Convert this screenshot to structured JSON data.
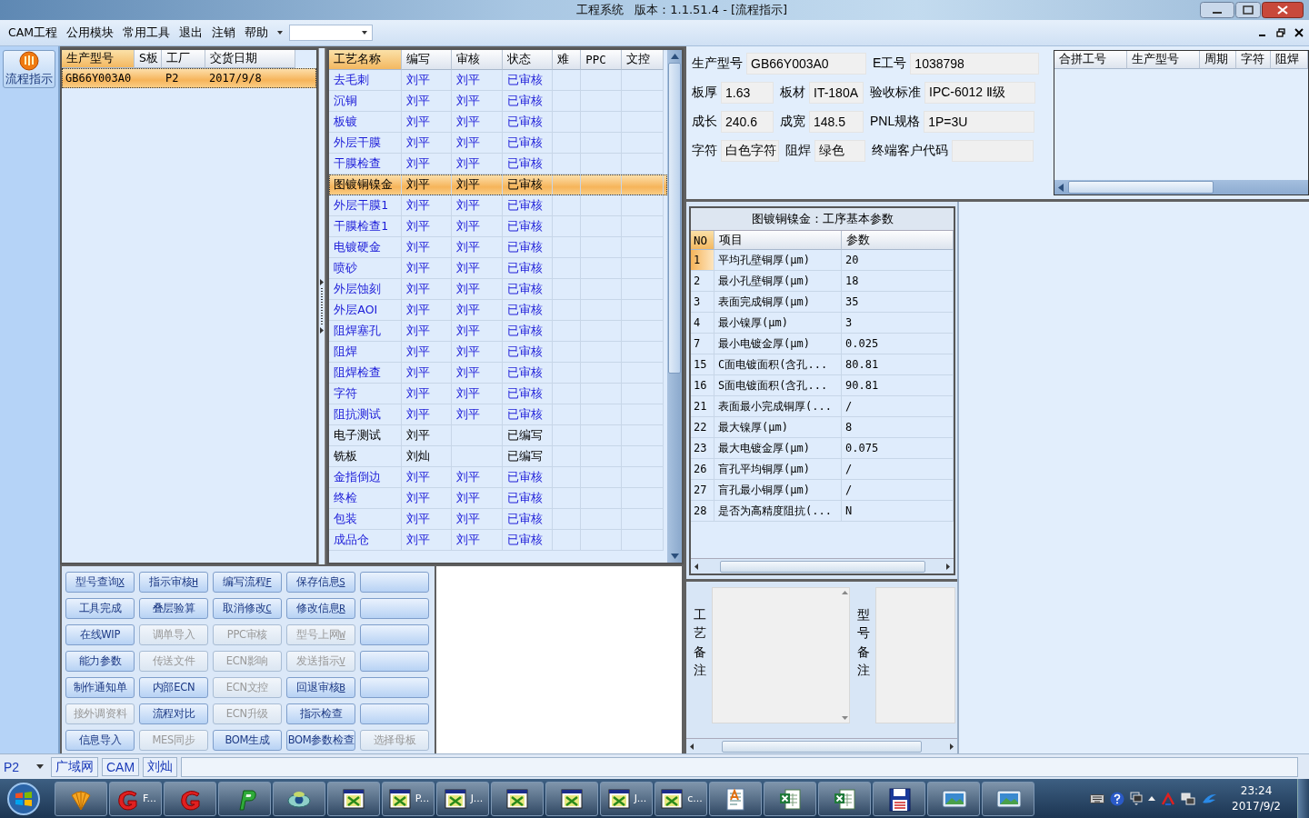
{
  "window": {
    "title": "工程系统   版本：1.1.51.4 - [流程指示]"
  },
  "menu": {
    "items": [
      "CAM工程",
      "公用模块",
      "常用工具",
      "退出",
      "注销",
      "帮助"
    ]
  },
  "side_button": {
    "label": "流程指示"
  },
  "product_table": {
    "columns": [
      "生产型号",
      "S板",
      "工厂",
      "交货日期"
    ],
    "rows": [
      {
        "model": "GB66Y003A0",
        "factory": "P2",
        "delivery": "2017/9/8",
        "selected": true
      }
    ]
  },
  "process_table": {
    "columns": [
      "工艺名称",
      "编写",
      "审核",
      "状态",
      "难",
      "PPC",
      "文控"
    ],
    "rows": [
      {
        "name": "去毛刺",
        "writer": "刘平",
        "reviewer": "刘平",
        "status": "已审核",
        "approved": true,
        "selected": false
      },
      {
        "name": "沉铜",
        "writer": "刘平",
        "reviewer": "刘平",
        "status": "已审核",
        "approved": true,
        "selected": false
      },
      {
        "name": "板镀",
        "writer": "刘平",
        "reviewer": "刘平",
        "status": "已审核",
        "approved": true,
        "selected": false
      },
      {
        "name": "外层干膜",
        "writer": "刘平",
        "reviewer": "刘平",
        "status": "已审核",
        "approved": true,
        "selected": false
      },
      {
        "name": "干膜检查",
        "writer": "刘平",
        "reviewer": "刘平",
        "status": "已审核",
        "approved": true,
        "selected": false
      },
      {
        "name": "图镀铜镍金",
        "writer": "刘平",
        "reviewer": "刘平",
        "status": "已审核",
        "approved": true,
        "selected": true
      },
      {
        "name": "外层干膜1",
        "writer": "刘平",
        "reviewer": "刘平",
        "status": "已审核",
        "approved": true,
        "selected": false
      },
      {
        "name": "干膜检查1",
        "writer": "刘平",
        "reviewer": "刘平",
        "status": "已审核",
        "approved": true,
        "selected": false
      },
      {
        "name": "电镀硬金",
        "writer": "刘平",
        "reviewer": "刘平",
        "status": "已审核",
        "approved": true,
        "selected": false
      },
      {
        "name": "喷砂",
        "writer": "刘平",
        "reviewer": "刘平",
        "status": "已审核",
        "approved": true,
        "selected": false
      },
      {
        "name": "外层蚀刻",
        "writer": "刘平",
        "reviewer": "刘平",
        "status": "已审核",
        "approved": true,
        "selected": false
      },
      {
        "name": "外层AOI",
        "writer": "刘平",
        "reviewer": "刘平",
        "status": "已审核",
        "approved": true,
        "selected": false
      },
      {
        "name": "阻焊塞孔",
        "writer": "刘平",
        "reviewer": "刘平",
        "status": "已审核",
        "approved": true,
        "selected": false
      },
      {
        "name": "阻焊",
        "writer": "刘平",
        "reviewer": "刘平",
        "status": "已审核",
        "approved": true,
        "selected": false
      },
      {
        "name": "阻焊检查",
        "writer": "刘平",
        "reviewer": "刘平",
        "status": "已审核",
        "approved": true,
        "selected": false
      },
      {
        "name": "字符",
        "writer": "刘平",
        "reviewer": "刘平",
        "status": "已审核",
        "approved": true,
        "selected": false
      },
      {
        "name": "阻抗测试",
        "writer": "刘平",
        "reviewer": "刘平",
        "status": "已审核",
        "approved": true,
        "selected": false
      },
      {
        "name": "电子测试",
        "writer": "刘平",
        "status": "已编写",
        "approved": false,
        "selected": false
      },
      {
        "name": "铣板",
        "writer": "刘灿",
        "status": "已编写",
        "approved": false,
        "selected": false
      },
      {
        "name": "金指倒边",
        "writer": "刘平",
        "reviewer": "刘平",
        "status": "已审核",
        "approved": true,
        "selected": false
      },
      {
        "name": "终检",
        "writer": "刘平",
        "reviewer": "刘平",
        "status": "已审核",
        "approved": true,
        "selected": false
      },
      {
        "name": "包装",
        "writer": "刘平",
        "reviewer": "刘平",
        "status": "已审核",
        "approved": true,
        "selected": false
      },
      {
        "name": "成品仓",
        "writer": "刘平",
        "reviewer": "刘平",
        "status": "已审核",
        "approved": true,
        "selected": false
      }
    ]
  },
  "buttons": [
    {
      "label": "型号查询",
      "key": "X",
      "disabled": false
    },
    {
      "label": "指示审核",
      "key": "H",
      "disabled": false
    },
    {
      "label": "编写流程",
      "key": "F",
      "disabled": false
    },
    {
      "label": "保存信息",
      "key": "S",
      "disabled": false
    },
    {
      "disabled": false
    },
    {
      "label": "工具完成",
      "disabled": false
    },
    {
      "label": "叠层验算",
      "disabled": false
    },
    {
      "label": "取消修改",
      "key": "C",
      "disabled": false
    },
    {
      "label": "修改信息",
      "key": "R",
      "disabled": false
    },
    {
      "disabled": false
    },
    {
      "label": "在线WIP",
      "disabled": false
    },
    {
      "label": "调单导入",
      "disabled": true
    },
    {
      "label": "PPC审核",
      "disabled": true
    },
    {
      "label": "型号上网",
      "key": "W",
      "disabled": true
    },
    {
      "disabled": false
    },
    {
      "label": "能力参数",
      "disabled": false
    },
    {
      "label": "传送文件",
      "disabled": true
    },
    {
      "label": "ECN影响",
      "disabled": true
    },
    {
      "label": "发送指示",
      "key": "V",
      "disabled": true
    },
    {
      "disabled": false
    },
    {
      "label": "制作通知单",
      "disabled": false
    },
    {
      "label": "内部ECN",
      "disabled": false
    },
    {
      "label": "ECN文控",
      "disabled": true
    },
    {
      "label": "回退审核",
      "key": "B",
      "disabled": false
    },
    {
      "disabled": false
    },
    {
      "label": "接外调资料",
      "disabled": true
    },
    {
      "label": "流程对比",
      "disabled": false
    },
    {
      "label": "ECN升级",
      "disabled": true
    },
    {
      "label": "指示检查",
      "disabled": false
    },
    {
      "disabled": false
    },
    {
      "label": "信息导入",
      "disabled": false
    },
    {
      "label": "MES同步",
      "disabled": true
    },
    {
      "label": "BOM生成",
      "disabled": false
    },
    {
      "label": "BOM参数检查",
      "disabled": false
    },
    {
      "label": "选择母板",
      "disabled": true
    }
  ],
  "info": {
    "fields": [
      {
        "label": "生产型号",
        "value": "GB66Y003A0"
      },
      {
        "label": "E工号",
        "value": "1038798"
      },
      {
        "label": "板厚",
        "value": "1.63"
      },
      {
        "label": "板材",
        "value": "IT-180A"
      },
      {
        "label": "验收标准",
        "value": "IPC-6012 Ⅱ级"
      },
      {
        "label": "成长",
        "value": "240.6"
      },
      {
        "label": "成宽",
        "value": "148.5"
      },
      {
        "label": "PNL规格",
        "value": "1P=3U"
      },
      {
        "label": "字符",
        "value": "白色字符"
      },
      {
        "label": "阻焊",
        "value": "绿色"
      },
      {
        "label": "终端客户代码"
      }
    ]
  },
  "merge_table": {
    "columns": [
      "合拼工号",
      "生产型号",
      "周期",
      "字符",
      "阻焊"
    ]
  },
  "params": {
    "title": "图镀铜镍金：工序基本参数",
    "columns": [
      "NO",
      "项目",
      "参数"
    ],
    "rows": [
      {
        "no": "1",
        "item": "平均孔壁铜厚(μm)",
        "value": "20",
        "selected": true
      },
      {
        "no": "2",
        "item": "最小孔壁铜厚(μm)",
        "value": "18",
        "selected": false
      },
      {
        "no": "3",
        "item": "表面完成铜厚(μm)",
        "value": "35",
        "selected": false
      },
      {
        "no": "4",
        "item": "最小镍厚(μm)",
        "value": "3",
        "selected": false
      },
      {
        "no": "7",
        "item": "最小电镀金厚(μm)",
        "value": "0.025",
        "selected": false
      },
      {
        "no": "15",
        "item": "C面电镀面积(含孔...",
        "value": "80.81",
        "selected": false
      },
      {
        "no": "16",
        "item": "S面电镀面积(含孔...",
        "value": "90.81",
        "selected": false
      },
      {
        "no": "21",
        "item": "表面最小完成铜厚(...",
        "value": "/",
        "selected": false
      },
      {
        "no": "22",
        "item": "最大镍厚(μm)",
        "value": "8",
        "selected": false
      },
      {
        "no": "23",
        "item": "最大电镀金厚(μm)",
        "value": "0.075",
        "selected": false
      },
      {
        "no": "26",
        "item": "盲孔平均铜厚(μm)",
        "value": "/",
        "selected": false
      },
      {
        "no": "27",
        "item": "盲孔最小铜厚(μm)",
        "value": "/",
        "selected": false
      },
      {
        "no": "28",
        "item": "是否为高精度阻抗(...",
        "value": "N",
        "selected": false
      }
    ]
  },
  "remarks": [
    {
      "label": "工艺备注"
    },
    {
      "label": "型号备注"
    }
  ],
  "status_bar": {
    "combo": "P2",
    "items": [
      "广域网",
      "CAM",
      "刘灿"
    ]
  },
  "taskbar": {
    "items": [
      {
        "kind": "shell"
      },
      {
        "kind": "g",
        "label": "F..."
      },
      {
        "kind": "g"
      },
      {
        "kind": "p"
      },
      {
        "kind": "eye"
      },
      {
        "kind": "win"
      },
      {
        "kind": "win",
        "label": "P..."
      },
      {
        "kind": "win",
        "label": "J..."
      },
      {
        "kind": "win"
      },
      {
        "kind": "win"
      },
      {
        "kind": "win",
        "label": "J..."
      },
      {
        "kind": "win",
        "label": "c..."
      },
      {
        "kind": "doc"
      },
      {
        "kind": "sheet"
      },
      {
        "kind": "sheet"
      },
      {
        "kind": "floppy"
      },
      {
        "kind": "screen"
      },
      {
        "kind": "screen"
      }
    ],
    "clock": {
      "time": "23:24",
      "date": "2017/9/2"
    }
  }
}
